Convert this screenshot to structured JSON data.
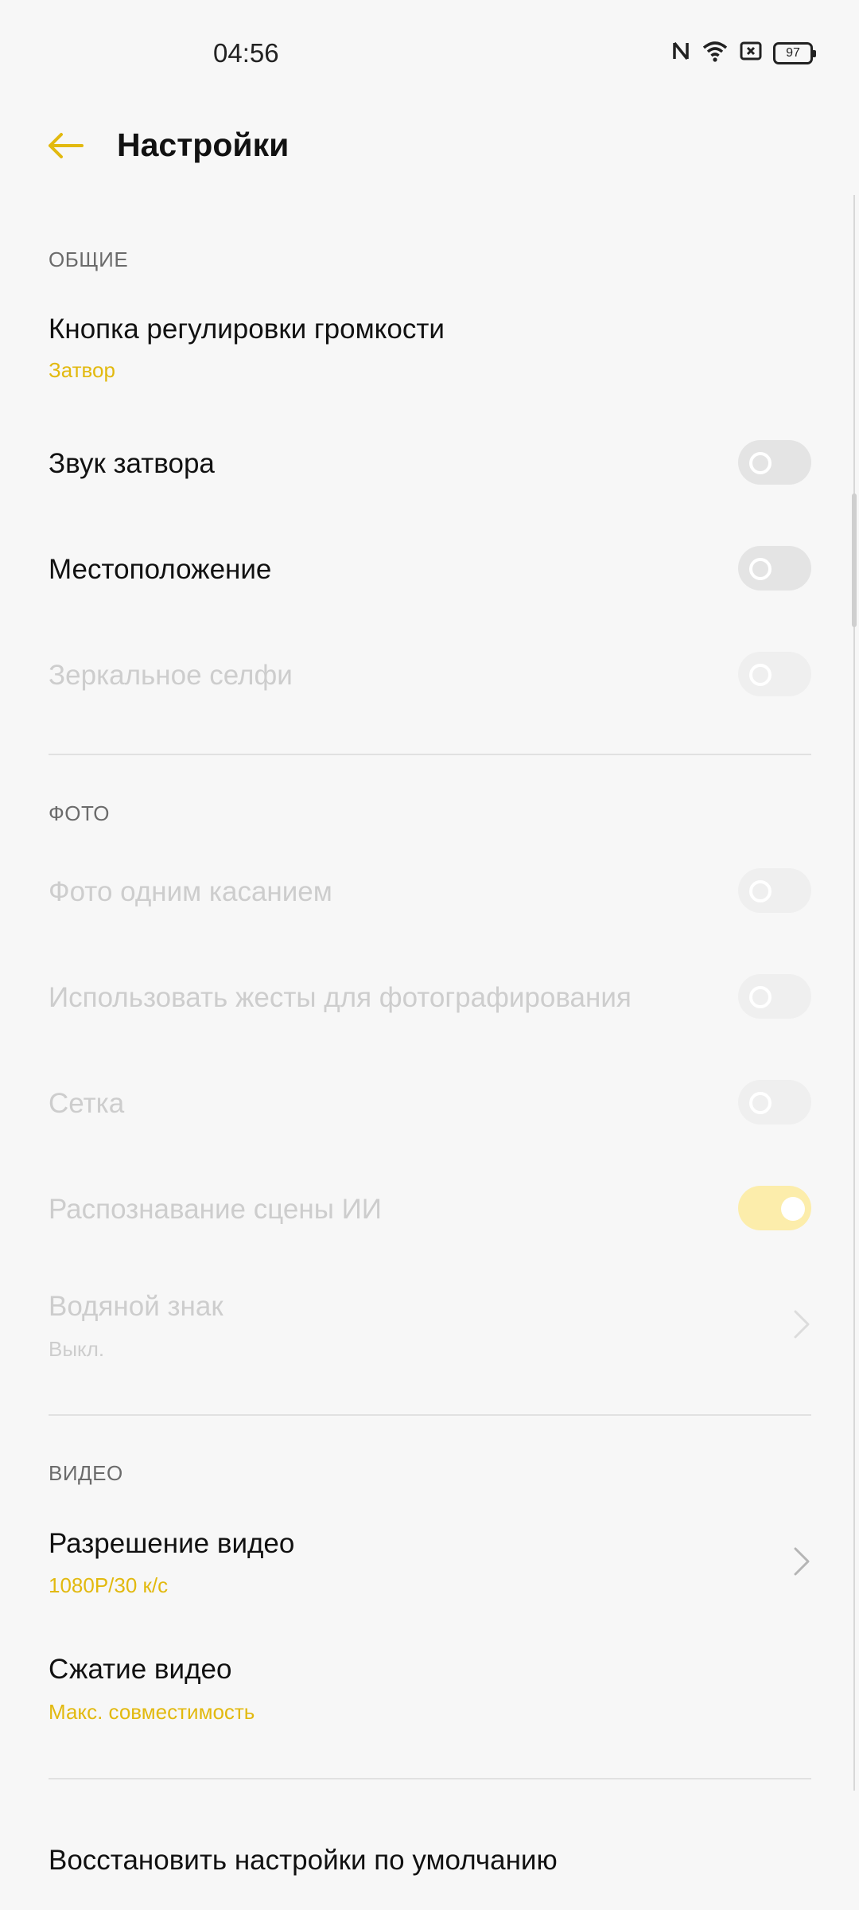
{
  "status_bar": {
    "time": "04:56",
    "battery": "97",
    "icons": [
      "nfc-icon",
      "wifi-icon",
      "sim-off-icon",
      "battery-icon"
    ]
  },
  "header": {
    "title": "Настройки",
    "back_icon": "arrow-left-icon"
  },
  "colors": {
    "accent": "#e2b90f",
    "disabled_text": "#cdcdcd",
    "toggle_off": "#e4e4e4",
    "toggle_on_disabled": "#fcedab"
  },
  "sections": {
    "general": {
      "header": "ОБЩИЕ",
      "volume_button": {
        "title": "Кнопка регулировки громкости",
        "value": "Затвор"
      },
      "shutter_sound": {
        "title": "Звук затвора",
        "enabled": false
      },
      "location": {
        "title": "Местоположение",
        "enabled": false
      },
      "mirror_selfie": {
        "title": "Зеркальное селфи",
        "enabled": false,
        "disabled": true
      }
    },
    "photo": {
      "header": "ФОТО",
      "one_touch": {
        "title": "Фото одним касанием",
        "enabled": false,
        "disabled": true
      },
      "gestures": {
        "title": "Использовать жесты для фотографирования",
        "enabled": false,
        "disabled": true
      },
      "grid": {
        "title": "Сетка",
        "enabled": false,
        "disabled": true
      },
      "ai_scene": {
        "title": "Распознавание сцены ИИ",
        "enabled": true,
        "disabled": true
      },
      "watermark": {
        "title": "Водяной знак",
        "value": "Выкл.",
        "disabled": true
      }
    },
    "video": {
      "header": "ВИДЕО",
      "resolution": {
        "title": "Разрешение видео",
        "value": "1080P/30 к/с"
      },
      "compression": {
        "title": "Сжатие видео",
        "value": "Макс. совместимость"
      }
    }
  },
  "restore_defaults": "Восстановить настройки по умолчанию"
}
